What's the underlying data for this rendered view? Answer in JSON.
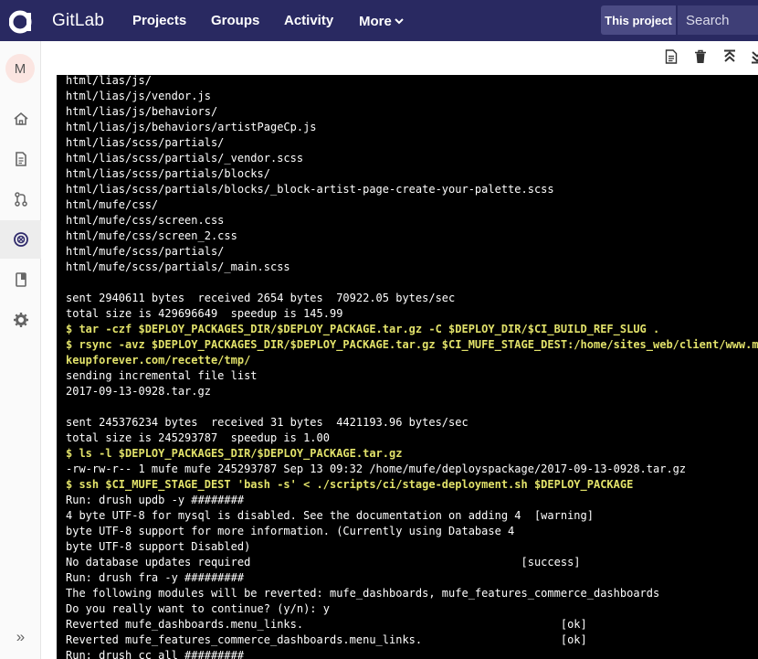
{
  "navbar": {
    "brand": "GitLab",
    "items": [
      {
        "label": "Projects"
      },
      {
        "label": "Groups"
      },
      {
        "label": "Activity"
      },
      {
        "label": "More"
      }
    ],
    "scope_label": "This project",
    "search_placeholder": "Search"
  },
  "sidebar": {
    "avatar_letter": "M",
    "icons": [
      "home-icon",
      "file-icon",
      "merge-request-icon",
      "pipeline-icon",
      "wiki-icon",
      "settings-icon"
    ],
    "active": "pipeline-icon",
    "collapse_glyph": "»"
  },
  "toolbar": {
    "icons": [
      "raw-log-icon",
      "erase-icon",
      "scroll-top-icon",
      "scroll-bottom-icon"
    ]
  },
  "colors": {
    "navbar_bg": "#292961",
    "scope_bg": "#4b4b84",
    "log_bg": "#000000",
    "log_text": "#ffffff",
    "command_text": "#e2e26a"
  },
  "log_lines": [
    {
      "text": "html/lias/js/",
      "cmd": false
    },
    {
      "text": "html/lias/js/vendor.js",
      "cmd": false
    },
    {
      "text": "html/lias/js/behaviors/",
      "cmd": false
    },
    {
      "text": "html/lias/js/behaviors/artistPageCp.js",
      "cmd": false
    },
    {
      "text": "html/lias/scss/partials/",
      "cmd": false
    },
    {
      "text": "html/lias/scss/partials/_vendor.scss",
      "cmd": false
    },
    {
      "text": "html/lias/scss/partials/blocks/",
      "cmd": false
    },
    {
      "text": "html/lias/scss/partials/blocks/_block-artist-page-create-your-palette.scss",
      "cmd": false
    },
    {
      "text": "html/mufe/css/",
      "cmd": false
    },
    {
      "text": "html/mufe/css/screen.css",
      "cmd": false
    },
    {
      "text": "html/mufe/css/screen_2.css",
      "cmd": false
    },
    {
      "text": "html/mufe/scss/partials/",
      "cmd": false
    },
    {
      "text": "html/mufe/scss/partials/_main.scss",
      "cmd": false
    },
    {
      "text": "",
      "cmd": false
    },
    {
      "text": "sent 2940611 bytes  received 2654 bytes  70922.05 bytes/sec",
      "cmd": false
    },
    {
      "text": "total size is 429696649  speedup is 145.99",
      "cmd": false
    },
    {
      "text": "$ tar -czf $DEPLOY_PACKAGES_DIR/$DEPLOY_PACKAGE.tar.gz -C $DEPLOY_DIR/$CI_BUILD_REF_SLUG .",
      "cmd": true
    },
    {
      "text": "$ rsync -avz $DEPLOY_PACKAGES_DIR/$DEPLOY_PACKAGE.tar.gz $CI_MUFE_STAGE_DEST:/home/sites_web/client/www.ma",
      "cmd": true
    },
    {
      "text": "keupforever.com/recette/tmp/",
      "cmd": true
    },
    {
      "text": "sending incremental file list",
      "cmd": false
    },
    {
      "text": "2017-09-13-0928.tar.gz",
      "cmd": false
    },
    {
      "text": "",
      "cmd": false
    },
    {
      "text": "sent 245376234 bytes  received 31 bytes  4421193.96 bytes/sec",
      "cmd": false
    },
    {
      "text": "total size is 245293787  speedup is 1.00",
      "cmd": false
    },
    {
      "text": "$ ls -l $DEPLOY_PACKAGES_DIR/$DEPLOY_PACKAGE.tar.gz",
      "cmd": true
    },
    {
      "text": "-rw-rw-r-- 1 mufe mufe 245293787 Sep 13 09:32 /home/mufe/deployspackage/2017-09-13-0928.tar.gz",
      "cmd": false
    },
    {
      "text": "$ ssh $CI_MUFE_STAGE_DEST 'bash -s' < ./scripts/ci/stage-deployment.sh $DEPLOY_PACKAGE",
      "cmd": true
    },
    {
      "text": "Run: drush updb -y ########",
      "cmd": false
    },
    {
      "text": "4 byte UTF-8 for mysql is disabled. See the documentation on adding 4  [warning]",
      "cmd": false
    },
    {
      "text": "byte UTF-8 support for more information. (Currently using Database 4",
      "cmd": false
    },
    {
      "text": "byte UTF-8 support Disabled)",
      "cmd": false
    },
    {
      "text": "No database updates required                                         [success]",
      "cmd": false
    },
    {
      "text": "Run: drush fra -y #########",
      "cmd": false
    },
    {
      "text": "The following modules will be reverted: mufe_dashboards, mufe_features_commerce_dashboards",
      "cmd": false
    },
    {
      "text": "Do you really want to continue? (y/n): y",
      "cmd": false
    },
    {
      "text": "Reverted mufe_dashboards.menu_links.                                       [ok]",
      "cmd": false
    },
    {
      "text": "Reverted mufe_features_commerce_dashboards.menu_links.                     [ok]",
      "cmd": false
    },
    {
      "text": "Run: drush cc all #########",
      "cmd": false
    }
  ]
}
